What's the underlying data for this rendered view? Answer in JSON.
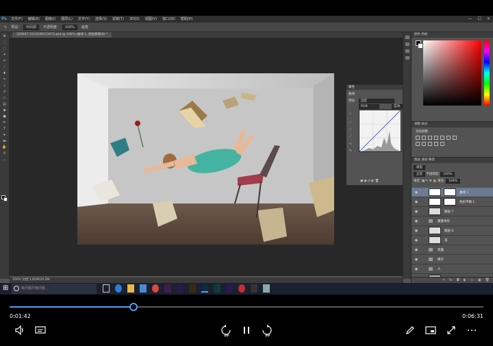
{
  "photoshop": {
    "logo": "Ps",
    "menu": [
      "文件(F)",
      "编辑(E)",
      "图像(I)",
      "图层(L)",
      "文字(Y)",
      "选择(S)",
      "滤镜(T)",
      "3D(D)",
      "视图(V)",
      "窗口(W)",
      "帮助(H)"
    ],
    "window_controls": [
      "—",
      "☐",
      "✕"
    ],
    "options": {
      "preset_label": "预设:",
      "preset_value": "中间调",
      "opacity_label": "不透明度:",
      "opacity_value": "100%",
      "brush_label": "画笔"
    },
    "document_tab": "320007-1512199111973.psd @ 100% (曲线 1, 图层蒙版/8) *",
    "status_text": "100%     文档:1.81M/29.2M",
    "properties_panel": {
      "title": "属性",
      "subtitle": "曲线",
      "preset_label": "预设:",
      "preset_value": "自定",
      "channel_value": "RGB",
      "auto_label": "自动"
    },
    "color_panel": {
      "tabs": "颜色  色板"
    },
    "adjust_panel": {
      "tabs": "调整  样式",
      "label": "添加调整"
    },
    "layers_panel": {
      "tabs": "图层  通道  路径",
      "kind_label": "类型",
      "blend_mode": "正常",
      "opacity_label": "不透明度:",
      "opacity_value": "100%",
      "lock_label": "锁定:",
      "fill_label": "填充:",
      "fill_value": "100%",
      "layers": [
        {
          "name": "曲线 1",
          "type": "adjust",
          "active": true
        },
        {
          "name": "色彩平衡 1",
          "type": "adjust",
          "active": false
        },
        {
          "name": "图层 7",
          "type": "pixel",
          "active": false
        },
        {
          "name": "飘落书页",
          "type": "group",
          "active": false
        },
        {
          "name": "图层 6",
          "type": "pixel",
          "active": false
        },
        {
          "name": "花",
          "type": "pixel",
          "active": false
        },
        {
          "name": "衣服",
          "type": "group",
          "active": false
        },
        {
          "name": "椅子",
          "type": "group",
          "active": false
        },
        {
          "name": "人",
          "type": "group",
          "active": false
        },
        {
          "name": "背景",
          "type": "background",
          "active": false
        }
      ]
    }
  },
  "taskbar": {
    "search_placeholder": "有问题尽管问我"
  },
  "player": {
    "current_time": "0:01:42",
    "total_time": "0:06:31",
    "progress_fraction": 0.2609,
    "skip_back": "10",
    "skip_forward": "30",
    "accent_color": "#4ea1f3"
  }
}
